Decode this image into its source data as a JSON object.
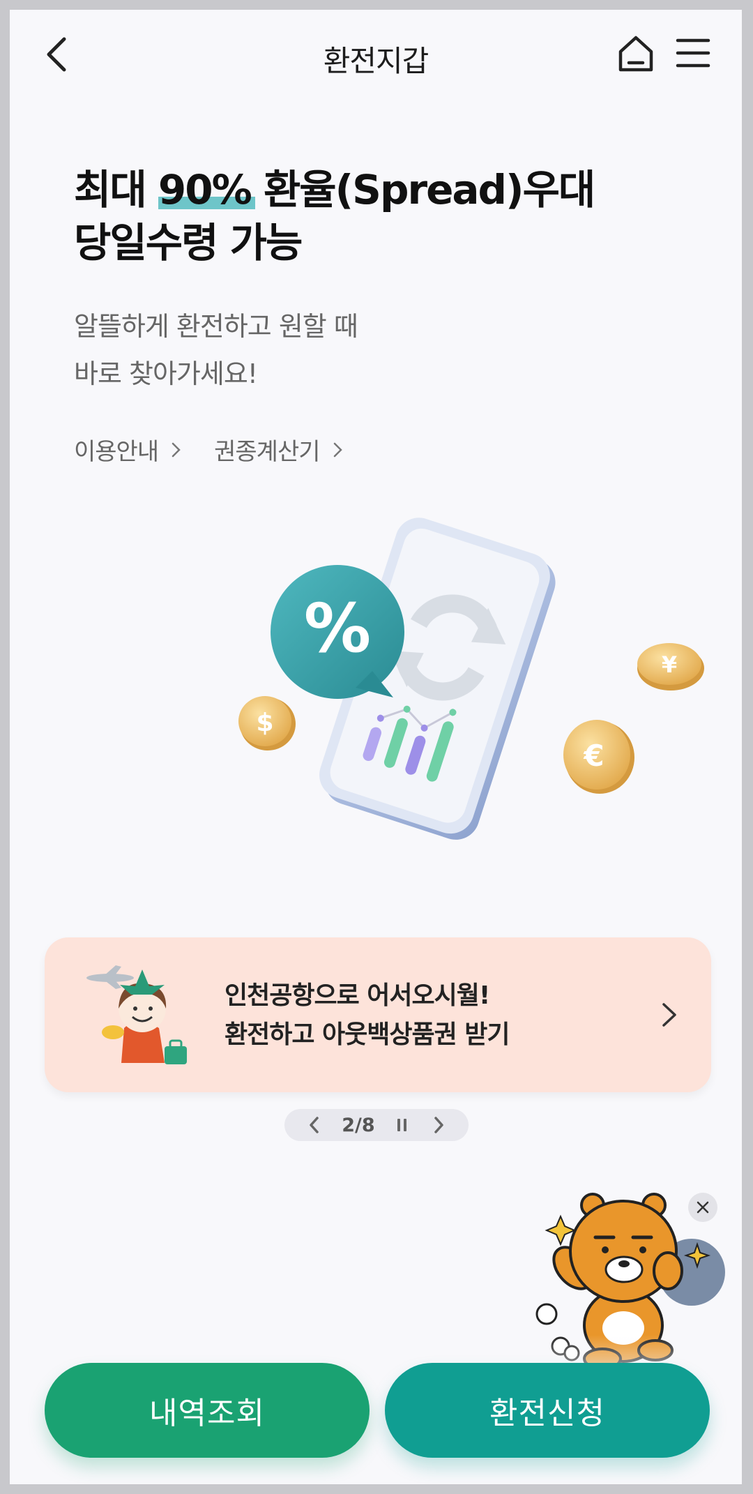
{
  "header": {
    "title": "환전지갑"
  },
  "hero": {
    "title_part1": "최대 ",
    "title_highlight": "90%",
    "title_part2": " 환율(Spread)우대",
    "title_line2": "당일수령 가능",
    "subtitle_line1": "알뜰하게 환전하고 원할 때",
    "subtitle_line2": "바로 찾아가세요!"
  },
  "links": [
    {
      "label": "이용안내"
    },
    {
      "label": "권종계산기"
    }
  ],
  "banner": {
    "line1": "인천공항으로 어서오시월!",
    "line2": "환전하고 아웃백상품권 받기"
  },
  "pager": {
    "text": "2/8"
  },
  "buttons": {
    "history": "내역조회",
    "apply": "환전신청"
  },
  "colors": {
    "accent_green": "#1aa272",
    "accent_teal": "#109e92",
    "highlight": "#6ec5c9",
    "banner_bg": "#fde3da"
  }
}
